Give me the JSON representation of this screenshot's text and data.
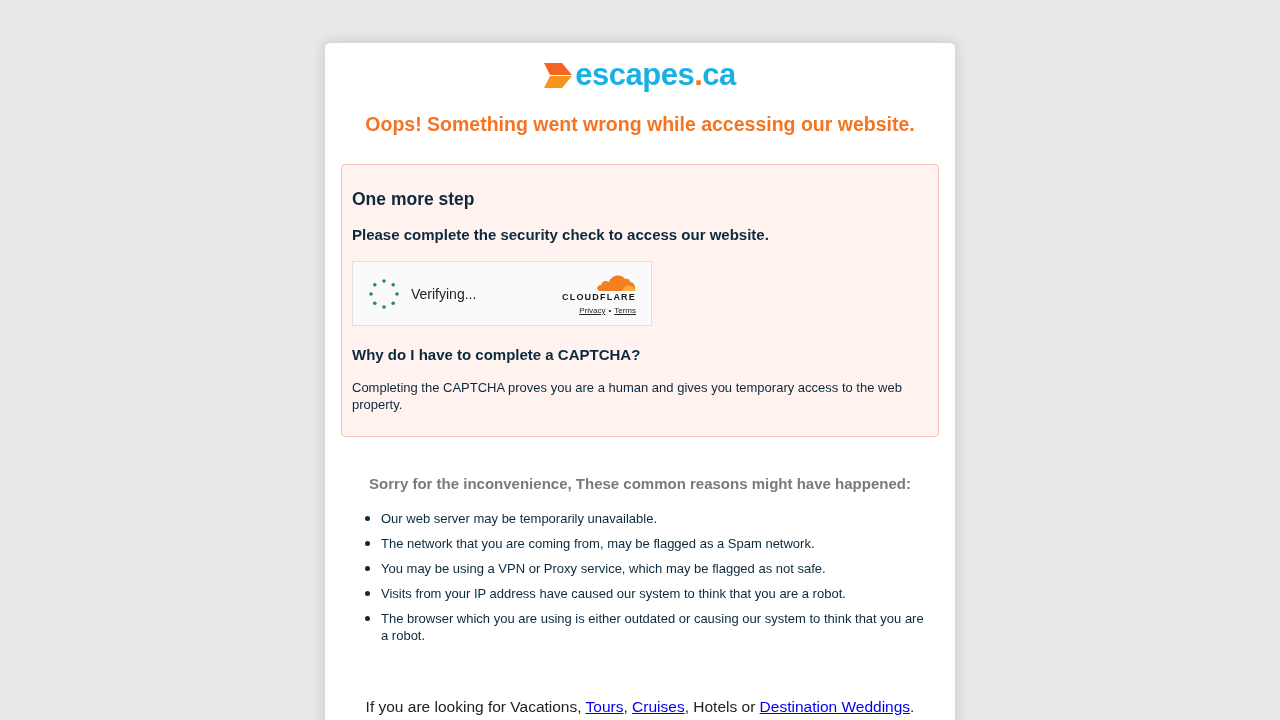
{
  "logo": {
    "parts": [
      {
        "kind": "name",
        "text": "escapes"
      },
      {
        "kind": "dot",
        "text": "."
      },
      {
        "kind": "name",
        "text": "ca"
      }
    ]
  },
  "heading": "Oops! Something went wrong while accessing our website.",
  "challenge": {
    "title": "One more step",
    "subtitle": "Please complete the security check to access our website.",
    "widget": {
      "status": "Verifying...",
      "brand": "CLOUDFLARE",
      "links": [
        {
          "kind": "link",
          "text": "Privacy"
        },
        {
          "kind": "separator",
          "text": "•"
        },
        {
          "kind": "link",
          "text": "Terms"
        }
      ]
    },
    "question": "Why do I have to complete a CAPTCHA?",
    "answer": "Completing the CAPTCHA proves you are a human and gives you temporary access to the web property."
  },
  "reasons": {
    "title": "Sorry for the inconvenience, These common reasons might have happened:",
    "items": [
      "Our web server may be temporarily unavailable.",
      "The network that you are coming from, may be flagged as a Spam network.",
      "You may be using a VPN or Proxy service, which may be flagged as not safe.",
      "Visits from your IP address have caused our system to think that you are a robot.",
      "The browser which you are using is either outdated or causing our system to think that you are a robot."
    ]
  },
  "footer": {
    "parts": [
      {
        "kind": "text",
        "text": "If you are looking for Vacations, "
      },
      {
        "kind": "link",
        "text": "Tours"
      },
      {
        "kind": "text",
        "text": ", "
      },
      {
        "kind": "link",
        "text": "Cruises"
      },
      {
        "kind": "text",
        "text": ", Hotels or "
      },
      {
        "kind": "link",
        "text": "Destination Weddings"
      },
      {
        "kind": "text",
        "text": "."
      }
    ]
  }
}
